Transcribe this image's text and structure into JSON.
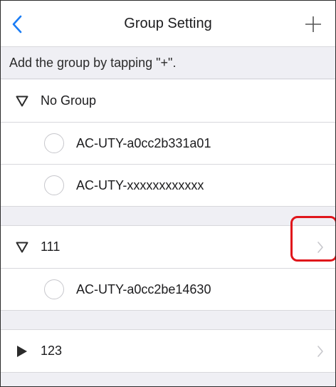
{
  "navbar": {
    "back_icon": "chevron-left-icon",
    "title": "Group Setting",
    "add_icon": "plus-icon",
    "accent": "#1a7cf5"
  },
  "hint": {
    "text": "Add the group by tapping \"+\"."
  },
  "groups": [
    {
      "label": "No Group",
      "expanded": true,
      "devices": [
        "AC-UTY-a0cc2b331a01",
        "AC-UTY-xxxxxxxxxxxx"
      ]
    },
    {
      "label": "111",
      "expanded": true,
      "devices": [
        "AC-UTY-a0cc2be14630"
      ]
    },
    {
      "label": "123",
      "expanded": false,
      "devices": []
    }
  ],
  "colors": {
    "background": "#efeff4",
    "row": "#ffffff",
    "highlight": "#e0151b",
    "chevron": "#c7c7cc"
  }
}
